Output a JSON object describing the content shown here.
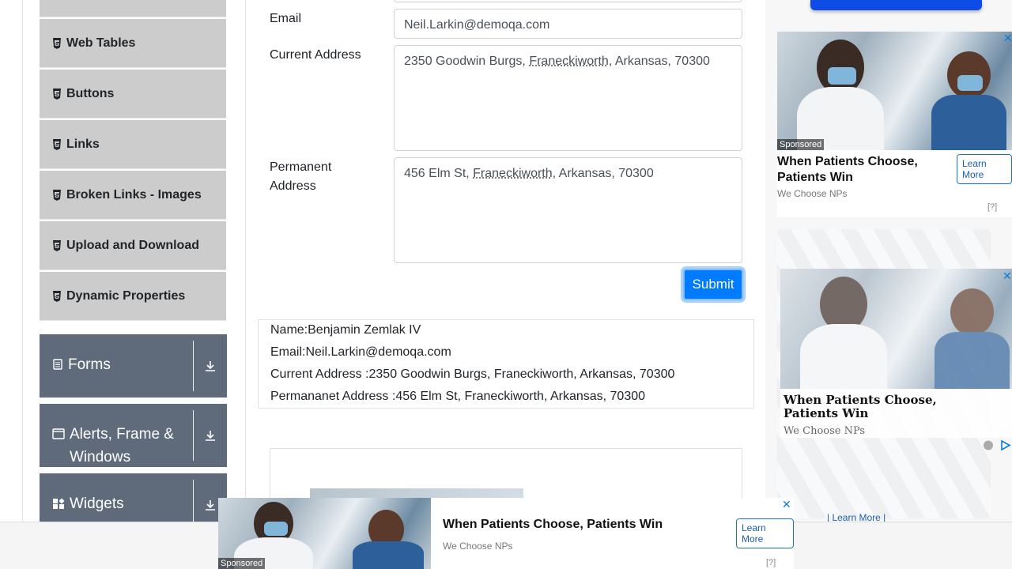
{
  "sidebar": {
    "elements_items": [
      {
        "label": "Web Tables"
      },
      {
        "label": "Buttons"
      },
      {
        "label": "Links"
      },
      {
        "label": "Broken Links - Images"
      },
      {
        "label": "Upload and Download"
      },
      {
        "label": "Dynamic Properties"
      }
    ],
    "groups": [
      {
        "label": "Forms"
      },
      {
        "label": "Alerts, Frame & Windows"
      },
      {
        "label": "Widgets"
      }
    ]
  },
  "form": {
    "email_label": "Email",
    "email_value": "Neil.Larkin@demoqa.com",
    "current_address_label": "Current Address",
    "current_address_prefix": "2350 Goodwin Burgs, ",
    "current_address_city": "Franeckiworth",
    "current_address_suffix": ", Arkansas, 70300",
    "permanent_address_label_1": "Permanent",
    "permanent_address_label_2": "Address",
    "permanent_address_prefix": "456 Elm St, ",
    "permanent_address_city": "Franeckiworth",
    "permanent_address_suffix": ", Arkansas, 70300",
    "submit_label": "Submit"
  },
  "output": {
    "name": "Name:Benjamin Zemlak IV",
    "email": "Email:Neil.Larkin@demoqa.com",
    "current_address": "Current Address :2350 Goodwin Burgs, Franeckiworth, Arkansas, 70300",
    "permanent_address": "Permananet Address :456 Elm St, Franeckiworth, Arkansas, 70300"
  },
  "ads": {
    "sponsored": "Sponsored",
    "title": "When Patients Choose, Patients Win",
    "title_line1": "When Patients Choose,",
    "title_line2": "Patients Win",
    "source": "We Choose NPs",
    "learn_more": "Learn More",
    "learn_more_link": "| Learn More |",
    "question": "[?]",
    "close": "✕"
  },
  "colors": {
    "primary": "#007bff",
    "group_bg": "#5f6b7a",
    "menu_bg": "#cccccc"
  }
}
